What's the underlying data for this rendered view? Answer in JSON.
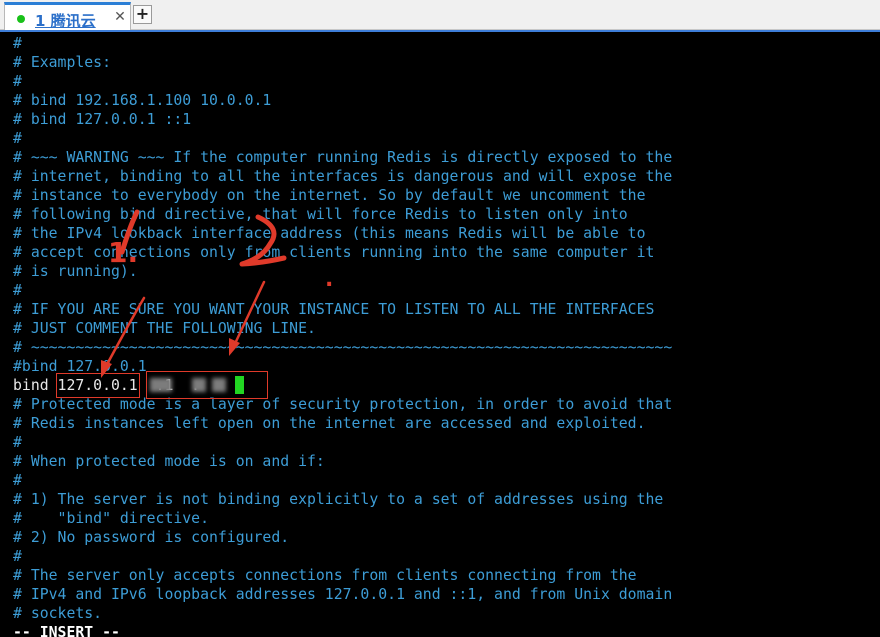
{
  "tabs": [
    {
      "label": "1 腾讯云",
      "active": true,
      "status": "connected"
    }
  ],
  "tab_controls": {
    "close": "✕",
    "add": "+"
  },
  "editor": {
    "lines": [
      "#",
      "# Examples:",
      "#",
      "# bind 192.168.1.100 10.0.0.1",
      "# bind 127.0.0.1 ::1",
      "#",
      "# ~~~ WARNING ~~~ If the computer running Redis is directly exposed to the",
      "# internet, binding to all the interfaces is dangerous and will expose the",
      "# instance to everybody on the internet. So by default we uncomment the",
      "# following bind directive, that will force Redis to listen only into",
      "# the IPv4 lookback interface address (this means Redis will be able to",
      "# accept connections only from clients running into the same computer it",
      "# is running).",
      "#",
      "# IF YOU ARE SURE YOU WANT YOUR INSTANCE TO LISTEN TO ALL THE INTERFACES",
      "# JUST COMMENT THE FOLLOWING LINE.",
      "# ~~~~~~~~~~~~~~~~~~~~~~~~~~~~~~~~~~~~~~~~~~~~~~~~~~~~~~~~~~~~~~~~~~~~~~~~",
      "#bind 127.0.0.1",
      "bind 127.0.0.1  .1  .",
      "# Protected mode is a layer of security protection, in order to avoid that",
      "# Redis instances left open on the internet are accessed and exploited.",
      "#",
      "# When protected mode is on and if:",
      "#",
      "# 1) The server is not binding explicitly to a set of addresses using the",
      "#    \"bind\" directive.",
      "# 2) No password is configured.",
      "#",
      "# The server only accepts connections from clients connecting from the",
      "# IPv4 and IPv6 loopback addresses 127.0.0.1 and ::1, and from Unix domain",
      "# sockets."
    ],
    "status_line": "-- INSERT --"
  },
  "annotations": [
    "1.",
    "2",
    "."
  ],
  "colors": {
    "comment": "#3d9dd6",
    "text": "#e8e8e8",
    "cursor": "#22d622",
    "annotation": "#e03a2a",
    "tab_accent": "#2b6fc9"
  }
}
